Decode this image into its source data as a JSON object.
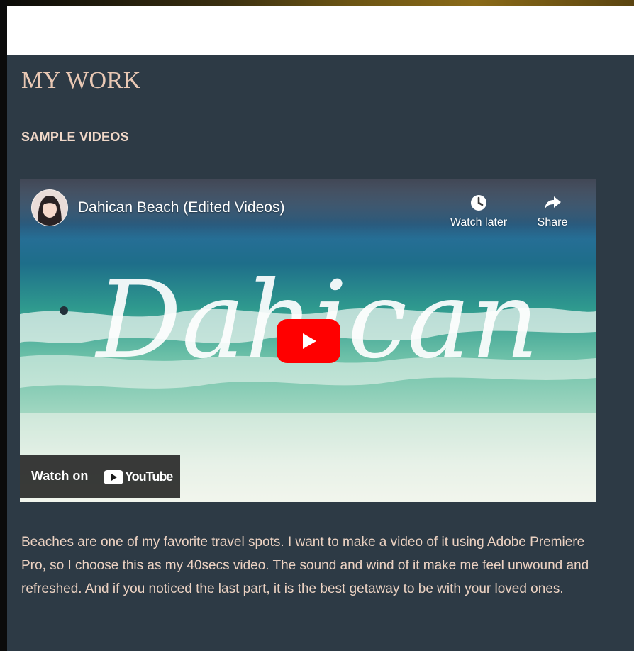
{
  "section": {
    "title": "MY WORK",
    "subtitle": "SAMPLE VIDEOS"
  },
  "video": {
    "title": "Dahican Beach (Edited Videos)",
    "overlay_text": "Dahican",
    "watch_later_label": "Watch later",
    "share_label": "Share",
    "watch_on_label": "Watch on",
    "youtube_label": "YouTube",
    "icons": [
      "clock-icon",
      "share-arrow-icon",
      "play-icon",
      "youtube-logo-icon"
    ],
    "colors": {
      "play_button": "#ff0000",
      "overlay_bar": "#191919"
    }
  },
  "description": "Beaches are one of my favorite travel spots. I want to make a video of it using Adobe Premiere Pro, so I choose this as my 40secs video. The sound and wind of it make me feel unwound and refreshed. And if you noticed the last part, it is the best getaway to be with your loved ones.",
  "colors": {
    "background": "#2d3a45",
    "heading": "#e9c8b4",
    "body_text": "#ecd2c2"
  }
}
